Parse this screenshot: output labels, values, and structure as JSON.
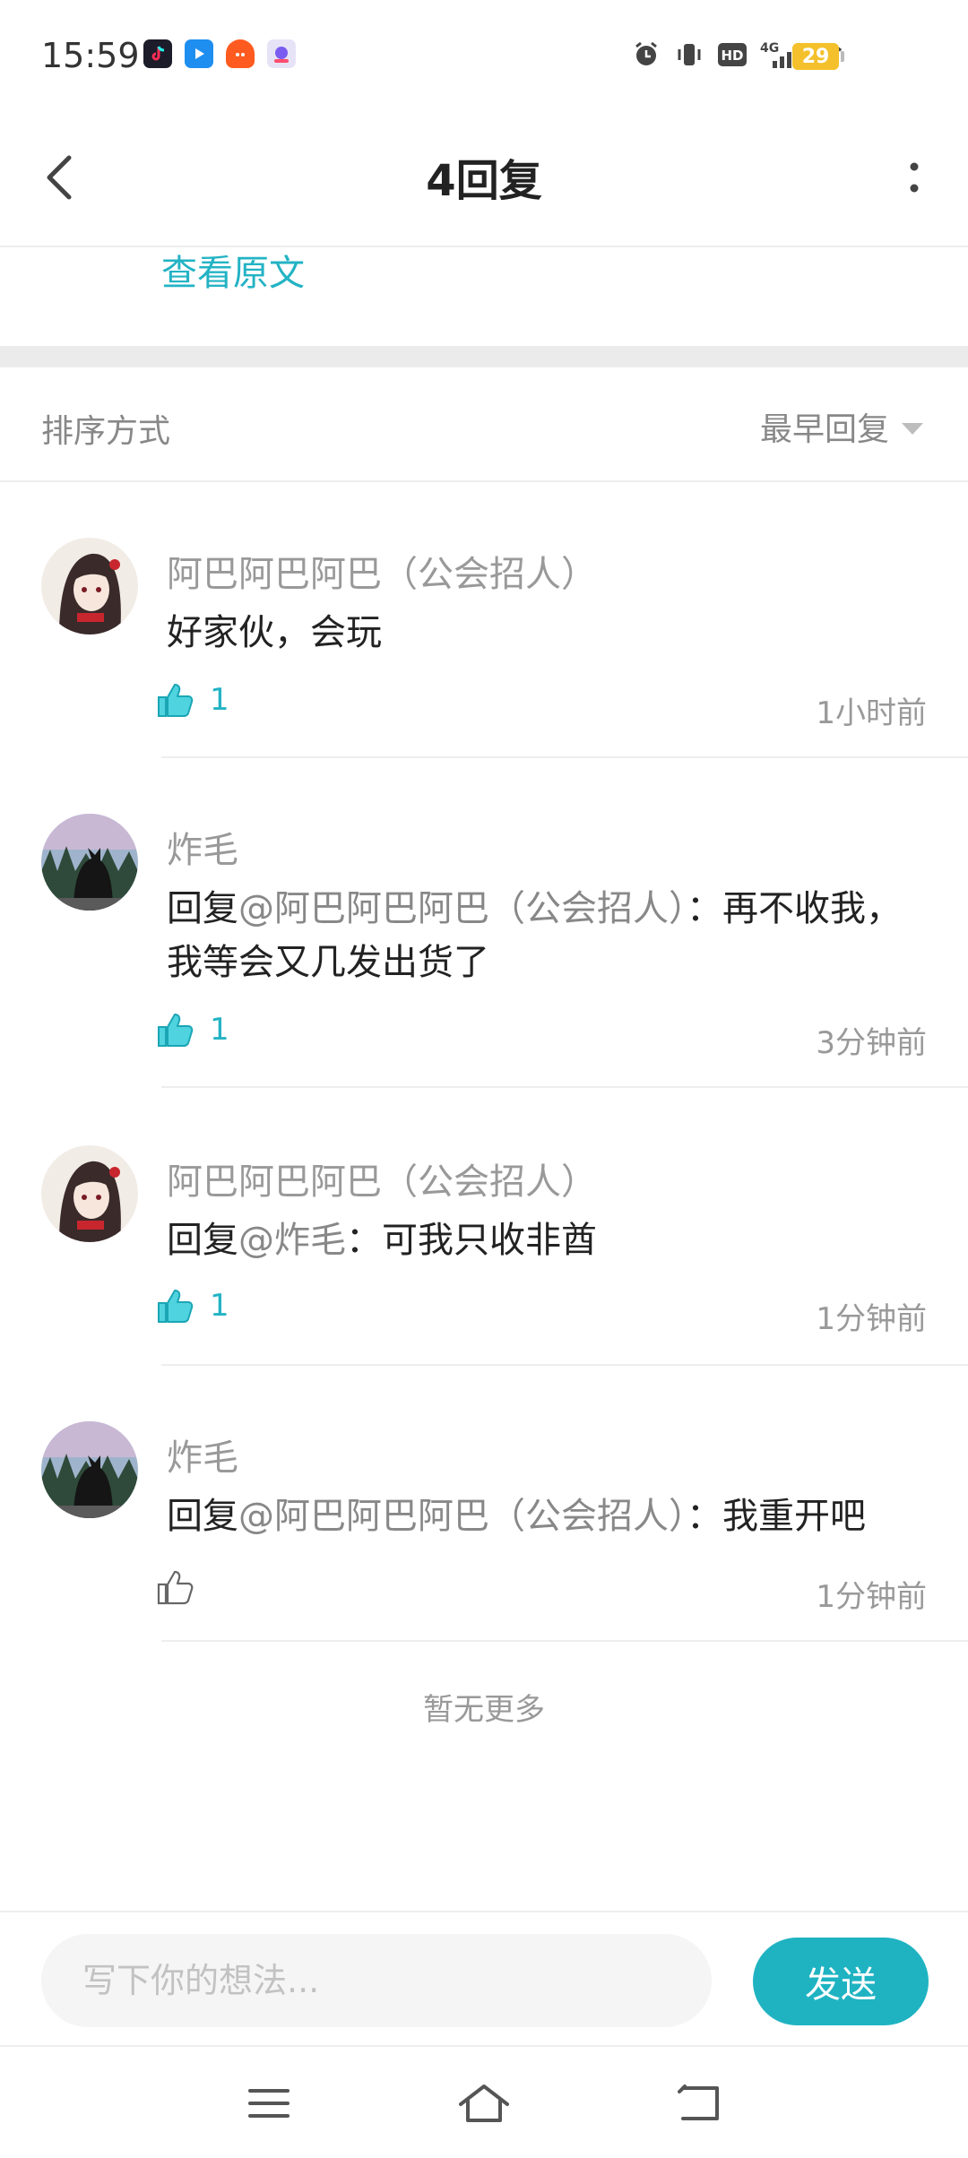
{
  "status_bar": {
    "time": "15:59",
    "network": "4G",
    "hd": "HD",
    "battery": "29",
    "app_icons": [
      "tiktok-icon",
      "bilibili-icon",
      "taobao-icon",
      "app-icon"
    ]
  },
  "header": {
    "title": "4回复",
    "back_icon": "chevron-left-icon",
    "more_icon": "more-vertical-icon"
  },
  "original": {
    "link": "查看原文"
  },
  "sort": {
    "label": "排序方式",
    "selected": "最早回复"
  },
  "replies": [
    {
      "author": "阿巴阿巴阿巴（公会招人）",
      "prefix": "",
      "mention": "",
      "text": "好家伙，会玩",
      "likes": "1",
      "time": "1小时前",
      "liked": true,
      "avatar": "anime-girl"
    },
    {
      "author": "炸毛",
      "prefix": "回复",
      "mention": "@阿巴阿巴阿巴（公会招人）",
      "text": "：再不收我，我等会又几发出货了",
      "likes": "1",
      "time": "3分钟前",
      "liked": true,
      "avatar": "black-cat"
    },
    {
      "author": "阿巴阿巴阿巴（公会招人）",
      "prefix": "回复",
      "mention": "@炸毛",
      "text": "：可我只收非酋",
      "likes": "1",
      "time": "1分钟前",
      "liked": true,
      "avatar": "anime-girl"
    },
    {
      "author": "炸毛",
      "prefix": "回复",
      "mention": "@阿巴阿巴阿巴（公会招人）",
      "text": "：我重开吧",
      "likes": "",
      "time": "1分钟前",
      "liked": false,
      "avatar": "black-cat"
    }
  ],
  "footer": {
    "no_more": "暂无更多"
  },
  "input": {
    "placeholder": "写下你的想法...",
    "value": "",
    "send_label": "发送"
  },
  "colors": {
    "accent": "#1fb3c2",
    "link": "#23b3c4",
    "battery": "#f4c12c"
  },
  "nav": [
    "menu-icon",
    "home-icon",
    "back-icon"
  ]
}
